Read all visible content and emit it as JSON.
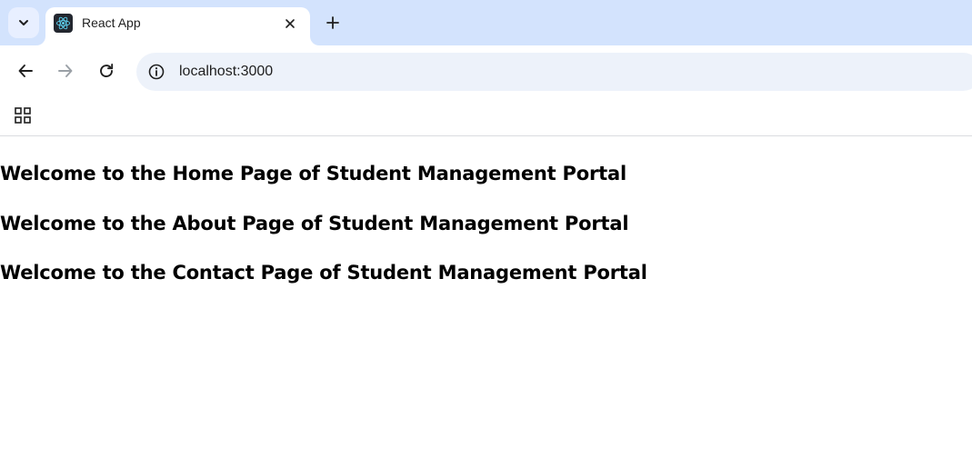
{
  "browser": {
    "tab": {
      "title": "React App",
      "favicon": "react-logo-icon"
    },
    "address_bar": {
      "url": "localhost:3000"
    },
    "icons": {
      "tab_search": "chevron-down-icon",
      "tab_close": "close-icon",
      "new_tab": "plus-icon",
      "back": "arrow-left-icon",
      "forward": "arrow-right-icon",
      "reload": "reload-icon",
      "site_info": "info-icon",
      "apps": "apps-grid-icon"
    },
    "colors": {
      "tabstrip": "#d3e3fd",
      "omnibox": "#edf2fa",
      "react_blue": "#61dafb"
    }
  },
  "page": {
    "headings": [
      "Welcome to the Home Page of Student Management Portal",
      "Welcome to the About Page of Student Management Portal",
      "Welcome to the Contact Page of Student Management Portal"
    ]
  }
}
